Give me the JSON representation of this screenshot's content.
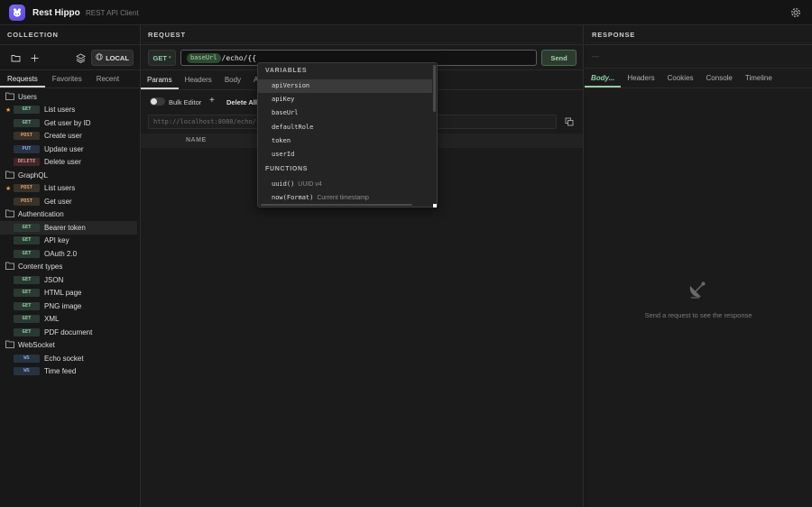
{
  "app": {
    "title": "Rest Hippo",
    "subtitle": "REST API Client"
  },
  "sidebar": {
    "header": "COLLECTION",
    "env_label": "LOCAL",
    "tabs": [
      "Requests",
      "Favorites",
      "Recent"
    ],
    "folders": [
      {
        "name": "Users",
        "items": [
          {
            "method": "GET",
            "label": "List users",
            "starred": true
          },
          {
            "method": "GET",
            "label": "Get user by ID",
            "starred": false
          },
          {
            "method": "POST",
            "label": "Create user",
            "starred": false
          },
          {
            "method": "PUT",
            "label": "Update user",
            "starred": false
          },
          {
            "method": "DELETE",
            "label": "Delete user",
            "starred": false
          }
        ]
      },
      {
        "name": "GraphQL",
        "items": [
          {
            "method": "POST",
            "label": "List users",
            "starred": true
          },
          {
            "method": "POST",
            "label": "Get user",
            "starred": false
          }
        ]
      },
      {
        "name": "Authentication",
        "items": [
          {
            "method": "GET",
            "label": "Bearer token",
            "starred": false,
            "selected": true
          },
          {
            "method": "GET",
            "label": "API key",
            "starred": false
          },
          {
            "method": "GET",
            "label": "OAuth 2.0",
            "starred": false
          }
        ]
      },
      {
        "name": "Content types",
        "items": [
          {
            "method": "GET",
            "label": "JSON",
            "starred": false
          },
          {
            "method": "GET",
            "label": "HTML page",
            "starred": false
          },
          {
            "method": "GET",
            "label": "PNG image",
            "starred": false
          },
          {
            "method": "GET",
            "label": "XML",
            "starred": false
          },
          {
            "method": "GET",
            "label": "PDF document",
            "starred": false
          }
        ]
      },
      {
        "name": "WebSocket",
        "items": [
          {
            "method": "WS",
            "label": "Echo socket",
            "starred": false
          },
          {
            "method": "WS",
            "label": "Time feed",
            "starred": false
          }
        ]
      }
    ]
  },
  "request": {
    "header": "REQUEST",
    "method": "GET",
    "url_var": "baseUrl",
    "url_rest": "/echo/{{",
    "send_label": "Send",
    "tabs": [
      "Params",
      "Headers",
      "Body",
      "A"
    ],
    "bulk_editor_label": "Bulk Editor",
    "delete_all_label": "Delete All",
    "preview_url": "http://localhost:8080/echo/{{",
    "table_name_header": "NAME"
  },
  "autocomplete": {
    "variables_header": "VARIABLES",
    "variables": [
      "apiVersion",
      "apiKey",
      "baseUrl",
      "defaultRole",
      "token",
      "userId"
    ],
    "functions_header": "FUNCTIONS",
    "functions": [
      {
        "name": "uuid()",
        "detail": "UUID v4"
      },
      {
        "name": "now(Format)",
        "detail": "Current timestamp"
      }
    ]
  },
  "response": {
    "header": "RESPONSE",
    "status_placeholder": "—",
    "tabs": [
      "Body...",
      "Headers",
      "Cookies",
      "Console",
      "Timeline"
    ],
    "empty_message": "Send a request to see the response"
  },
  "colors": {
    "accent": "#7c6cf2",
    "get": "#8fcfa4",
    "post": "#d9a06a",
    "put": "#86a8e0",
    "delete": "#e18a8a",
    "star": "#e8a33c"
  }
}
